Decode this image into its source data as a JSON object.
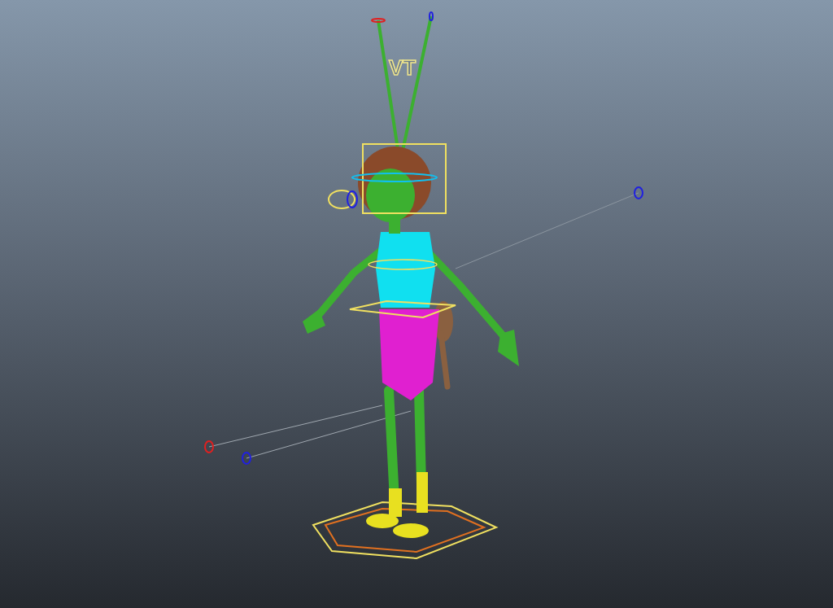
{
  "viewport": {
    "rig_label": "VT"
  }
}
